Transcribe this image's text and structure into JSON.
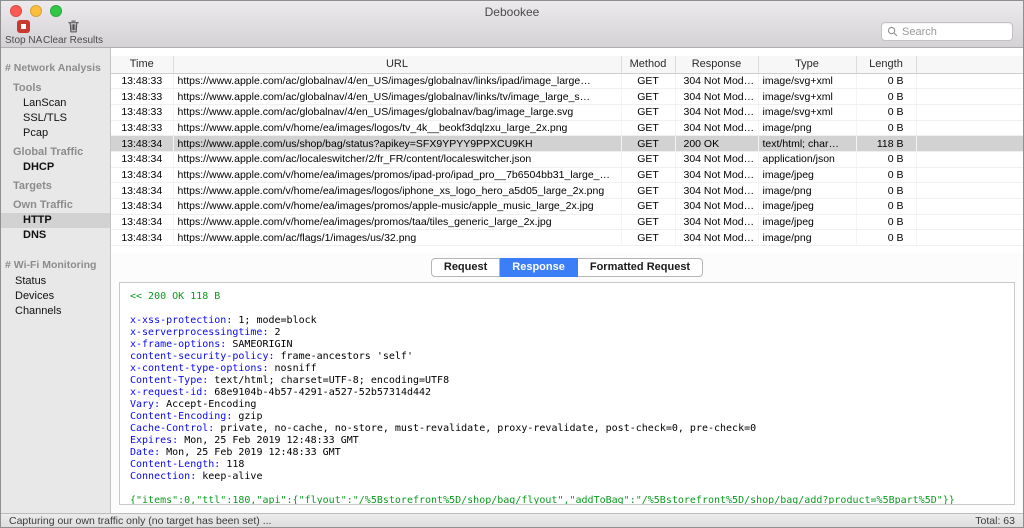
{
  "window": {
    "title": "Debookee"
  },
  "toolbar": {
    "stop_label": "Stop NA",
    "clear_label": "Clear Results",
    "search_placeholder": "Search"
  },
  "sidebar": {
    "items": [
      {
        "label": "# Network Analysis",
        "kind": "section"
      },
      {
        "label": "Tools",
        "kind": "group"
      },
      {
        "label": "LanScan",
        "kind": "item"
      },
      {
        "label": "SSL/TLS",
        "kind": "item"
      },
      {
        "label": "Pcap",
        "kind": "item"
      },
      {
        "label": "Global Traffic",
        "kind": "group"
      },
      {
        "label": "DHCP",
        "kind": "item",
        "bold": true
      },
      {
        "label": "Targets",
        "kind": "group"
      },
      {
        "label": "Own Traffic",
        "kind": "group"
      },
      {
        "label": "HTTP",
        "kind": "item",
        "bold": true,
        "selected": true
      },
      {
        "label": "DNS",
        "kind": "item",
        "bold": true
      },
      {
        "label": "# Wi-Fi Monitoring",
        "kind": "section"
      },
      {
        "label": "Status",
        "kind": "subitem"
      },
      {
        "label": "Devices",
        "kind": "subitem"
      },
      {
        "label": "Channels",
        "kind": "subitem"
      }
    ]
  },
  "table": {
    "columns": [
      "Time",
      "URL",
      "Method",
      "Response",
      "Type",
      "Length"
    ],
    "selected_row": 4,
    "rows": [
      [
        "13:48:33",
        "https://www.apple.com/ac/globalnav/4/en_US/images/globalnav/links/ipad/image_large…",
        "GET",
        "304 Not Mod…",
        "image/svg+xml",
        "0 B"
      ],
      [
        "13:48:33",
        "https://www.apple.com/ac/globalnav/4/en_US/images/globalnav/links/tv/image_large_s…",
        "GET",
        "304 Not Mod…",
        "image/svg+xml",
        "0 B"
      ],
      [
        "13:48:33",
        "https://www.apple.com/ac/globalnav/4/en_US/images/globalnav/bag/image_large.svg",
        "GET",
        "304 Not Mod…",
        "image/svg+xml",
        "0 B"
      ],
      [
        "13:48:33",
        "https://www.apple.com/v/home/ea/images/logos/tv_4k__beokf3dqlzxu_large_2x.png",
        "GET",
        "304 Not Mod…",
        "image/png",
        "0 B"
      ],
      [
        "13:48:34",
        "https://www.apple.com/us/shop/bag/status?apikey=SFX9YPYY9PPXCU9KH",
        "GET",
        "200 OK",
        "text/html; char…",
        "118 B"
      ],
      [
        "13:48:34",
        "https://www.apple.com/ac/localeswitcher/2/fr_FR/content/localeswitcher.json",
        "GET",
        "304 Not Mod…",
        "application/json",
        "0 B"
      ],
      [
        "13:48:34",
        "https://www.apple.com/v/home/ea/images/promos/ipad-pro/ipad_pro__7b6504bb31_large_…",
        "GET",
        "304 Not Mod…",
        "image/jpeg",
        "0 B"
      ],
      [
        "13:48:34",
        "https://www.apple.com/v/home/ea/images/logos/iphone_xs_logo_hero_a5d05_large_2x.png",
        "GET",
        "304 Not Mod…",
        "image/png",
        "0 B"
      ],
      [
        "13:48:34",
        "https://www.apple.com/v/home/ea/images/promos/apple-music/apple_music_large_2x.jpg",
        "GET",
        "304 Not Mod…",
        "image/jpeg",
        "0 B"
      ],
      [
        "13:48:34",
        "https://www.apple.com/v/home/ea/images/promos/taa/tiles_generic_large_2x.jpg",
        "GET",
        "304 Not Mod…",
        "image/jpeg",
        "0 B"
      ],
      [
        "13:48:34",
        "https://www.apple.com/ac/flags/1/images/us/32.png",
        "GET",
        "304 Not Mod…",
        "image/png",
        "0 B"
      ]
    ]
  },
  "detail": {
    "tabs": [
      "Request",
      "Response",
      "Formatted Request"
    ],
    "selected_tab": "Response",
    "status_line": "<< 200 OK 118 B",
    "headers": [
      [
        "x-xss-protection",
        "1; mode=block"
      ],
      [
        "x-serverprocessingtime",
        "2"
      ],
      [
        "x-frame-options",
        "SAMEORIGIN"
      ],
      [
        "content-security-policy",
        "frame-ancestors 'self'"
      ],
      [
        "x-content-type-options",
        "nosniff"
      ],
      [
        "Content-Type",
        "text/html; charset=UTF-8; encoding=UTF8"
      ],
      [
        "x-request-id",
        "68e9104b-4b57-4291-a527-52b57314d442"
      ],
      [
        "Vary",
        "Accept-Encoding"
      ],
      [
        "Content-Encoding",
        "gzip"
      ],
      [
        "Cache-Control",
        "private, no-cache, no-store, must-revalidate, proxy-revalidate, post-check=0, pre-check=0"
      ],
      [
        "Expires",
        "Mon, 25 Feb 2019 12:48:33 GMT"
      ],
      [
        "Date",
        "Mon, 25 Feb 2019 12:48:33 GMT"
      ],
      [
        "Content-Length",
        "118"
      ],
      [
        "Connection",
        "keep-alive"
      ]
    ],
    "body": "{\"items\":0,\"ttl\":180,\"api\":{\"flyout\":\"/%5Bstorefront%5D/shop/bag/flyout\",\"addToBag\":\"/%5Bstorefront%5D/shop/bag/add?product=%5Bpart%5D\"}}"
  },
  "status_bar": {
    "left": "Capturing our own traffic only (no target has been set) ...",
    "right": "Total: 63"
  },
  "colors": {
    "accent_blue": "#3c7ef7",
    "header_key_blue": "#0a0af0",
    "green": "#0a9a1e",
    "stop_red": "#c9392f",
    "selection_gray": "#d2d2d2"
  }
}
